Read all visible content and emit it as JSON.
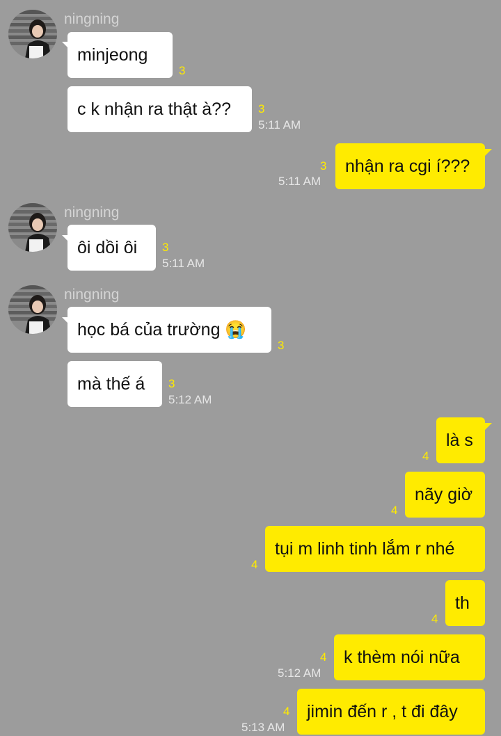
{
  "sender_name": "ningning",
  "messages": [
    {
      "text": "minjeong",
      "unread": "3",
      "time": ""
    },
    {
      "text": "c k nhận ra thật à??",
      "unread": "3",
      "time": "5:11 AM"
    },
    {
      "text": "nhận ra cgi í???",
      "unread": "3",
      "time": "5:11 AM"
    },
    {
      "text": "ôi dồi ôi",
      "unread": "3",
      "time": "5:11 AM"
    },
    {
      "text": "học bá của trường 😭",
      "unread": "3",
      "time": ""
    },
    {
      "text": "mà thế á",
      "unread": "3",
      "time": "5:12 AM"
    },
    {
      "text": "là s",
      "unread": "4",
      "time": ""
    },
    {
      "text": "nãy giờ",
      "unread": "4",
      "time": ""
    },
    {
      "text": "tụi m linh tinh lắm r nhé",
      "unread": "4",
      "time": ""
    },
    {
      "text": "th",
      "unread": "4",
      "time": ""
    },
    {
      "text": "k thèm nói nữa",
      "unread": "4",
      "time": "5:12 AM"
    },
    {
      "text": "jimin đến r , t đi đây",
      "unread": "4",
      "time": "5:13 AM"
    }
  ],
  "colors": {
    "background": "#9c9c9c",
    "incoming_bubble": "#ffffff",
    "outgoing_bubble": "#ffeb00",
    "unread_count": "#ffeb00"
  }
}
